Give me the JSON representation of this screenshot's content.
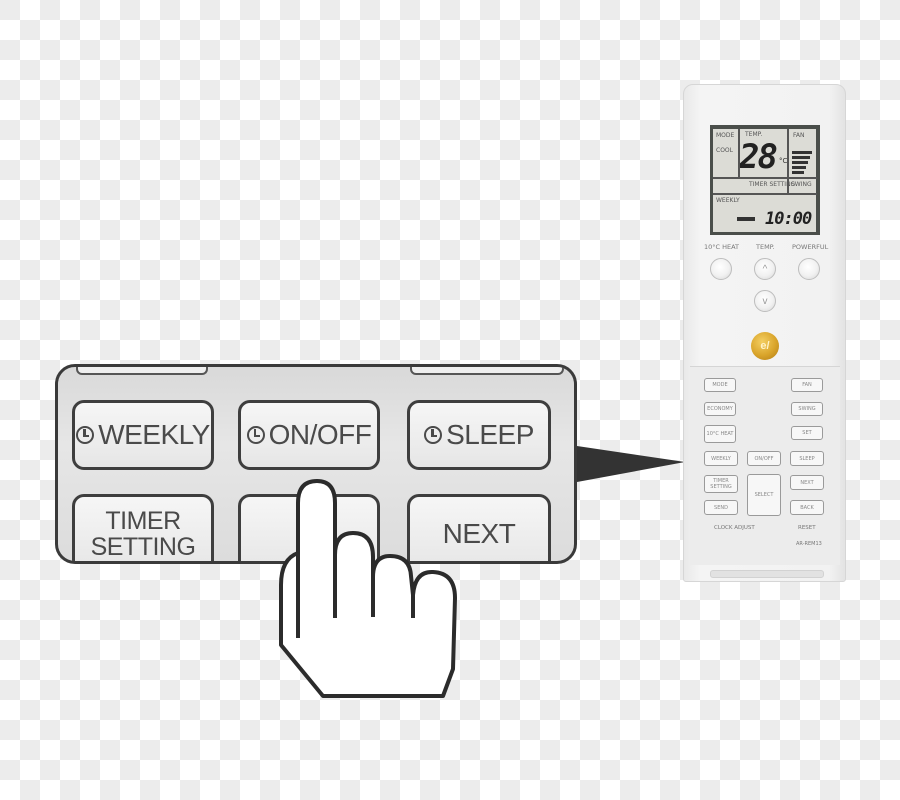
{
  "panel": {
    "buttons": [
      {
        "id": "weekly",
        "label": "WEEKLY",
        "has_clock_icon": true
      },
      {
        "id": "on_off",
        "label": "ON/OFF",
        "has_clock_icon": true
      },
      {
        "id": "sleep",
        "label": "SLEEP",
        "has_clock_icon": true
      },
      {
        "id": "timer_setting",
        "label_line1": "TIMER",
        "label_line2": "SETTING"
      },
      {
        "id": "blank",
        "label": ""
      },
      {
        "id": "next",
        "label": "NEXT"
      }
    ],
    "pressed_button": "blank",
    "pointer_icon": "hand-pointer-icon"
  },
  "remote": {
    "lcd": {
      "mode_label": "MODE",
      "mode_value": "COOL",
      "temp_label": "TEMP.",
      "temp_value": "28",
      "temp_unit": "°C",
      "fan_label": "FAN",
      "fan_bars": 5,
      "timer_mode": "WEEKLY",
      "time": "10:00",
      "mid_label": "TIMER SETTING",
      "swing_label": "SWING"
    },
    "top_buttons": {
      "left_label": "10°C HEAT",
      "temp_label": "TEMP.",
      "right_label": "POWERFUL",
      "temp_up": "^",
      "temp_down": "v"
    },
    "center_button": "e/",
    "small_buttons": [
      {
        "label": "MODE"
      },
      {
        "label": "FAN"
      },
      {
        "label": "ECONOMY"
      },
      {
        "label": "SWING"
      },
      {
        "label": "10°C HEAT"
      },
      {
        "label": "SET"
      },
      {
        "label": "WEEKLY"
      },
      {
        "label": "ON/OFF"
      },
      {
        "label": "SLEEP"
      },
      {
        "label": "TIMER SETTING"
      },
      {
        "label": "SELECT"
      },
      {
        "label": "NEXT"
      },
      {
        "label": "SEND"
      },
      {
        "label": "BACK"
      }
    ],
    "clock_adjust_label": "CLOCK ADJUST",
    "reset_label": "RESET",
    "model_label": "AR-REM13"
  }
}
